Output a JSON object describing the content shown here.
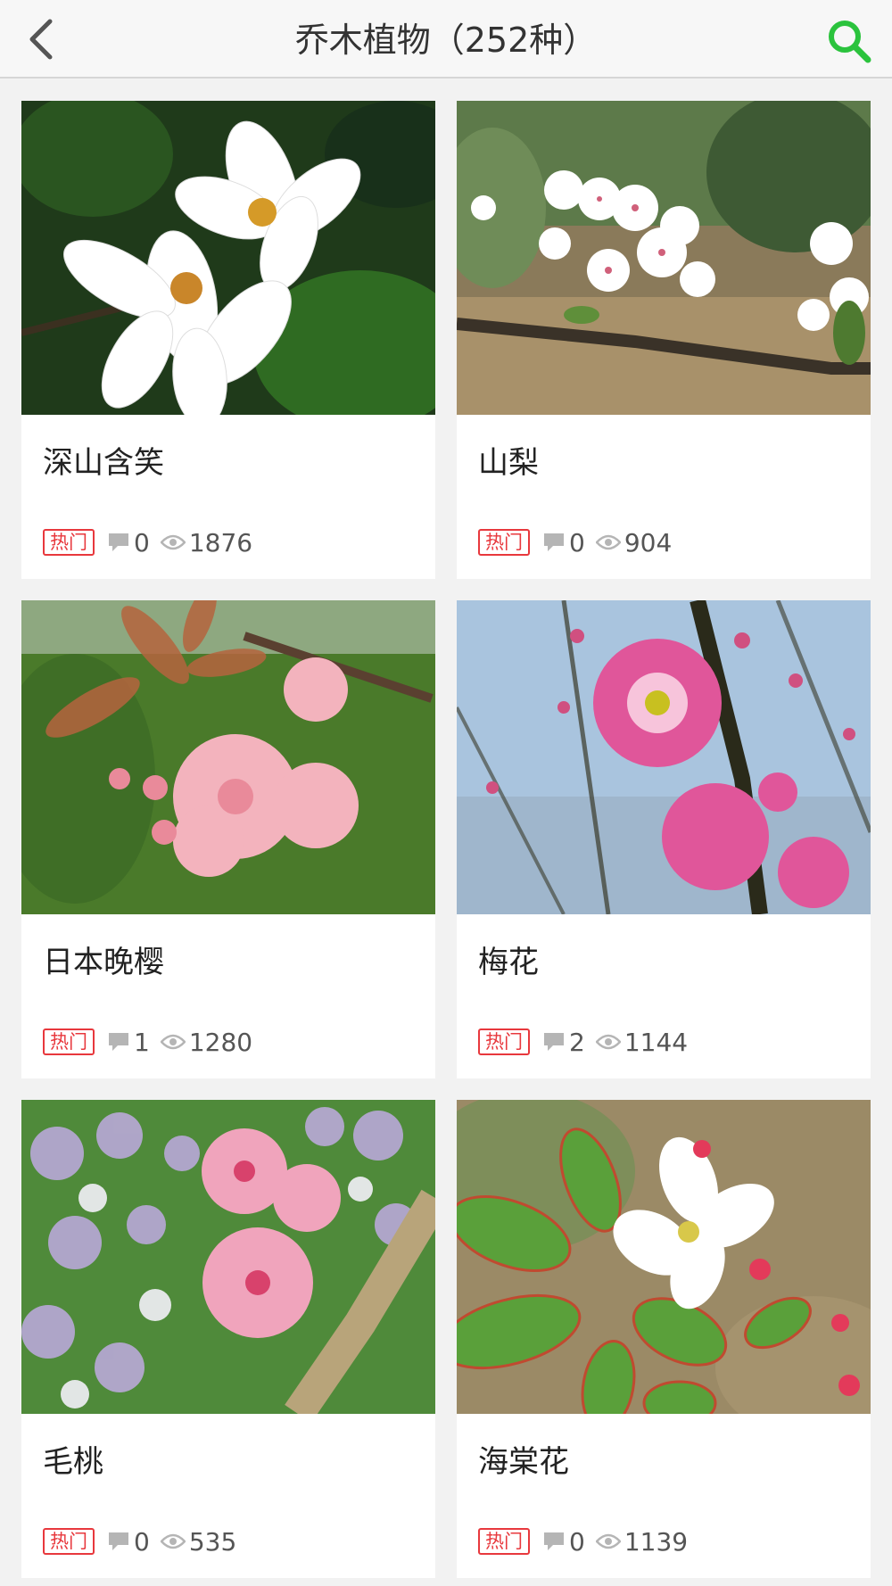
{
  "header": {
    "title": "乔木植物（252种）",
    "back_icon": "chevron-left-icon",
    "search_icon": "search-icon",
    "accent_color": "#2bc33d"
  },
  "plants": [
    {
      "name": "深山含笑",
      "badge": "热门",
      "comments": "0",
      "views": "1876"
    },
    {
      "name": "山梨",
      "badge": "热门",
      "comments": "0",
      "views": "904"
    },
    {
      "name": "日本晚樱",
      "badge": "热门",
      "comments": "1",
      "views": "1280"
    },
    {
      "name": "梅花",
      "badge": "热门",
      "comments": "2",
      "views": "1144"
    },
    {
      "name": "毛桃",
      "badge": "热门",
      "comments": "0",
      "views": "535"
    },
    {
      "name": "海棠花",
      "badge": "热门",
      "comments": "0",
      "views": "1139"
    }
  ],
  "colors": {
    "badge": "#e8383d"
  }
}
